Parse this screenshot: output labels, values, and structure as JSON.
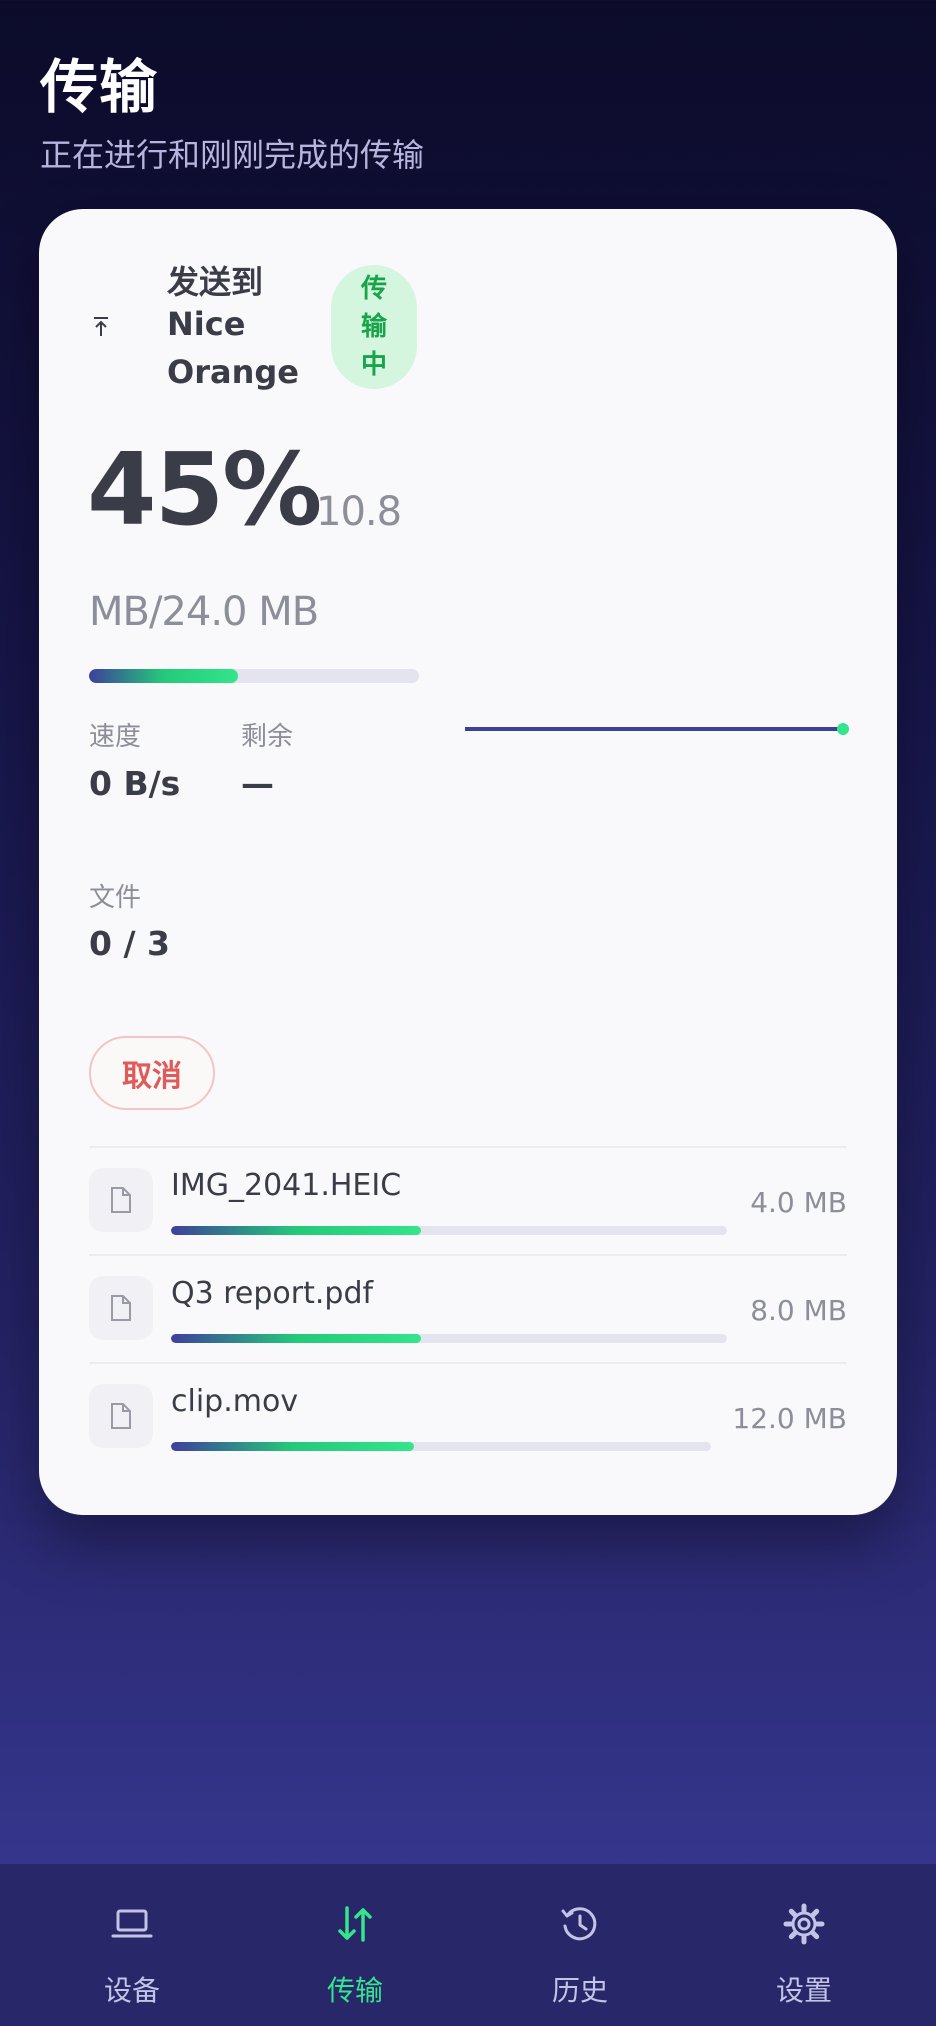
{
  "header": {
    "title": "传输",
    "subtitle": "正在进行和刚刚完成的传输"
  },
  "transfer": {
    "direction_label": "发送到",
    "peer_line1": "Nice",
    "peer_line2": "Orange",
    "status": "传输中",
    "percent_text": "45%",
    "progress": 0.45,
    "transferred": "10.8",
    "total": "MB/24.0 MB",
    "speed_label": "速度",
    "speed_value": "0 B/s",
    "remaining_label": "剩余",
    "remaining_value": "—",
    "files_label": "文件",
    "files_value": "0 / 3",
    "cancel_label": "取消"
  },
  "files": [
    {
      "name": "IMG_2041.HEIC",
      "size": "4.0 MB",
      "progress": 0.45
    },
    {
      "name": "Q3 report.pdf",
      "size": "8.0 MB",
      "progress": 0.45
    },
    {
      "name": "clip.mov",
      "size": "12.0 MB",
      "progress": 0.45
    }
  ],
  "nav": [
    {
      "label": "设备",
      "icon": "laptop-icon",
      "active": false
    },
    {
      "label": "传输",
      "icon": "arrows-up-down-icon",
      "active": true
    },
    {
      "label": "历史",
      "icon": "history-icon",
      "active": false
    },
    {
      "label": "设置",
      "icon": "gear-icon",
      "active": false
    }
  ],
  "colors": {
    "accent": "#33e58b",
    "primary": "#3e3f9a",
    "danger": "#e05a5a",
    "badge_bg": "#d4f5de",
    "badge_text": "#18a44a"
  }
}
